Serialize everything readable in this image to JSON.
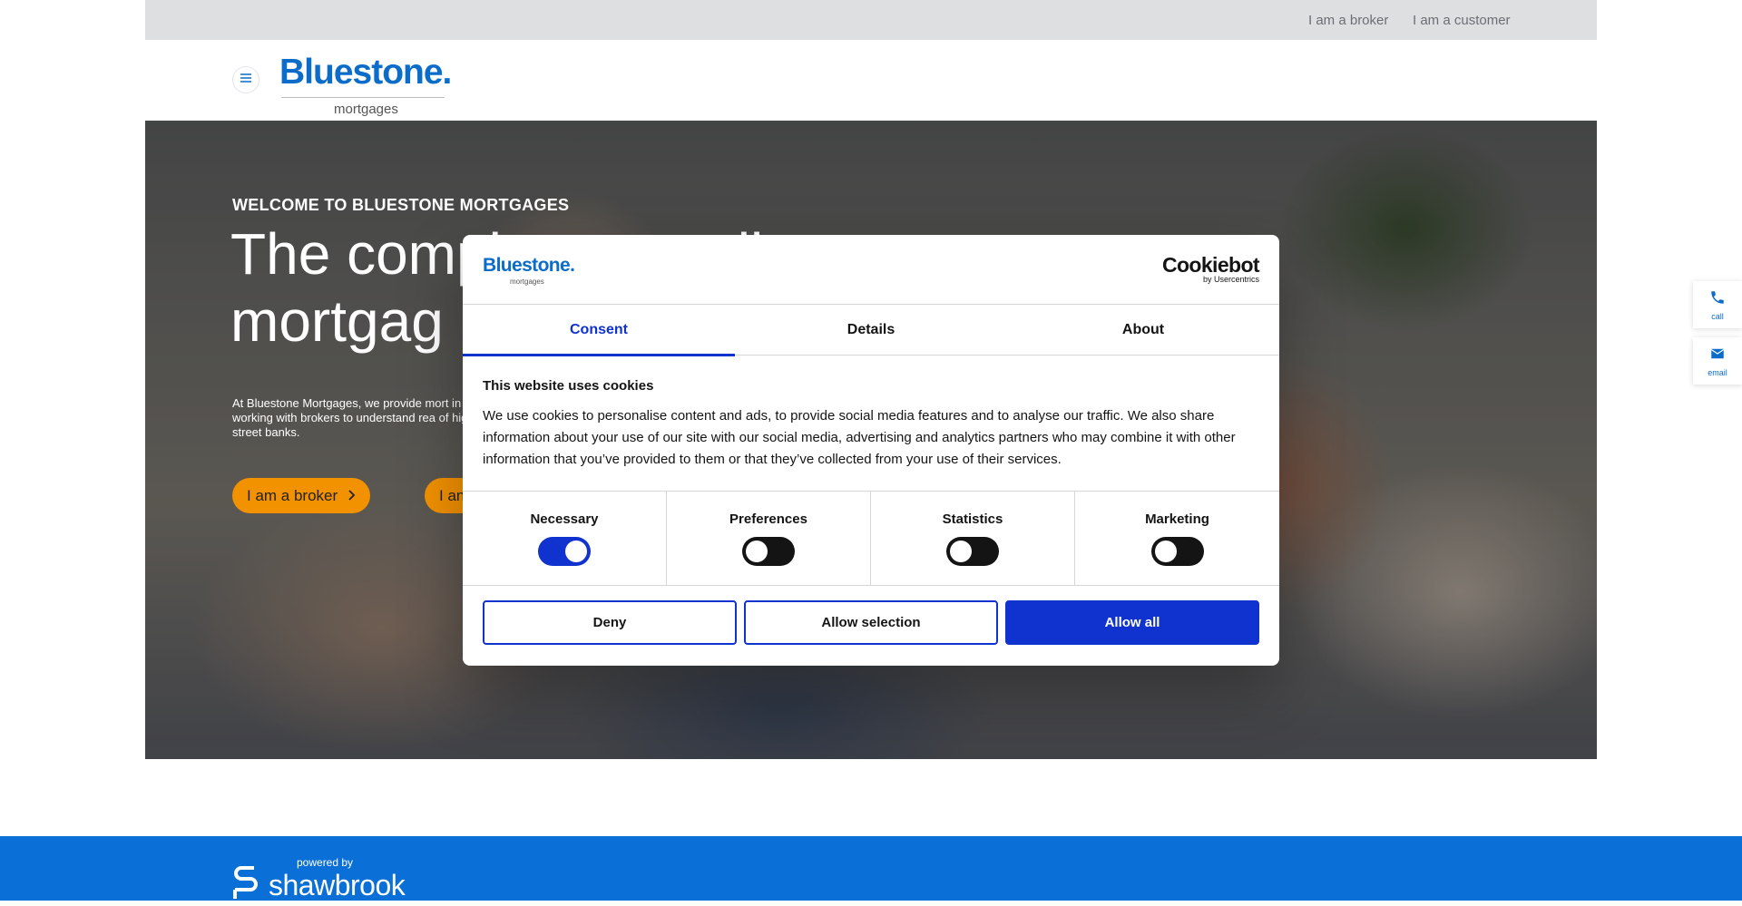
{
  "topbar": {
    "broker_link": "I am a broker",
    "customer_link": "I am a customer"
  },
  "header": {
    "logo_text": "Bluestone",
    "logo_dot": ".",
    "logo_subtext": "mortgages"
  },
  "hero": {
    "eyebrow": "WELCOME TO BLUESTONE MORTGAGES",
    "title_line1": "The compl",
    "title_line1_tail": "li",
    "title_line2": "mortgag",
    "text": "At Bluestone Mortgages, we provide mort in working with brokers to understand rea of high street banks.",
    "broker_button": "I am a broker",
    "customer_button": "I an"
  },
  "side_contact": {
    "call_label": "call",
    "email_label": "email"
  },
  "footer": {
    "powered_by": "powered by",
    "brand": "shawbrook"
  },
  "cookie_dialog": {
    "logo_text": "Bluestone.",
    "logo_subtext": "mortgages",
    "provider": "Cookiebot",
    "provider_sub": "by Usercentrics",
    "tabs": [
      {
        "label": "Consent",
        "active": true
      },
      {
        "label": "Details",
        "active": false
      },
      {
        "label": "About",
        "active": false
      }
    ],
    "title": "This website uses cookies",
    "body": "We use cookies to personalise content and ads, to provide social media features and to analyse our traffic. We also share information about your use of our site with our social media, advertising and analytics partners who may combine it with other information that you’ve provided to them or that they’ve collected from your use of their services.",
    "toggles": [
      {
        "label": "Necessary",
        "on": true
      },
      {
        "label": "Preferences",
        "on": false
      },
      {
        "label": "Statistics",
        "on": false
      },
      {
        "label": "Marketing",
        "on": false
      }
    ],
    "buttons": {
      "deny": "Deny",
      "allow_selection": "Allow selection",
      "allow_all": "Allow all"
    },
    "colors": {
      "accent": "#1032cf",
      "brand_blue": "#0b6cc9",
      "cta_orange": "#f39200"
    }
  }
}
